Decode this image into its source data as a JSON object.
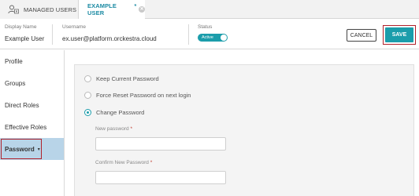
{
  "tabs": [
    {
      "label": "MANAGED USERS",
      "icon": "users-icon"
    },
    {
      "label": "EXAMPLE USER",
      "modified_marker": "*",
      "icon": "close-icon"
    }
  ],
  "header": {
    "display_name": {
      "label": "Display Name",
      "value": "Example User"
    },
    "username": {
      "label": "Username",
      "value": "ex.user@platform.orckestra.cloud"
    },
    "status": {
      "label": "Status",
      "value": "Active"
    },
    "cancel_label": "CANCEL",
    "save_label": "SAVE"
  },
  "sidebar": {
    "items": [
      {
        "label": "Profile"
      },
      {
        "label": "Groups"
      },
      {
        "label": "Direct Roles"
      },
      {
        "label": "Effective Roles"
      },
      {
        "label": "Password",
        "caret": "▾",
        "selected": true
      }
    ]
  },
  "password": {
    "options": [
      {
        "label": "Keep Current Password",
        "checked": false
      },
      {
        "label": "Force Reset Password on next login",
        "checked": false
      },
      {
        "label": "Change Password",
        "checked": true
      }
    ],
    "new_password_label": "New password",
    "confirm_password_label": "Confirm New Password",
    "required_marker": "*"
  },
  "colors": {
    "accent": "#1b9dab",
    "highlight": "#b0202a",
    "selected_bg": "#b8d4e8"
  }
}
